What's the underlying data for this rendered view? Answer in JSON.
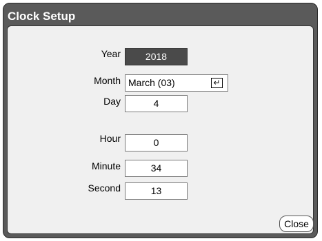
{
  "window": {
    "title": "Clock Setup"
  },
  "fields": {
    "year": {
      "label": "Year",
      "value": "2018"
    },
    "month": {
      "label": "Month",
      "value": "March (03)",
      "icon": "enter-icon"
    },
    "day": {
      "label": "Day",
      "value": "4"
    },
    "hour": {
      "label": "Hour",
      "value": "0"
    },
    "minute": {
      "label": "Minute",
      "value": "34"
    },
    "second": {
      "label": "Second",
      "value": "13"
    }
  },
  "buttons": {
    "close": "Close"
  },
  "icons": {
    "enter": "↵"
  }
}
